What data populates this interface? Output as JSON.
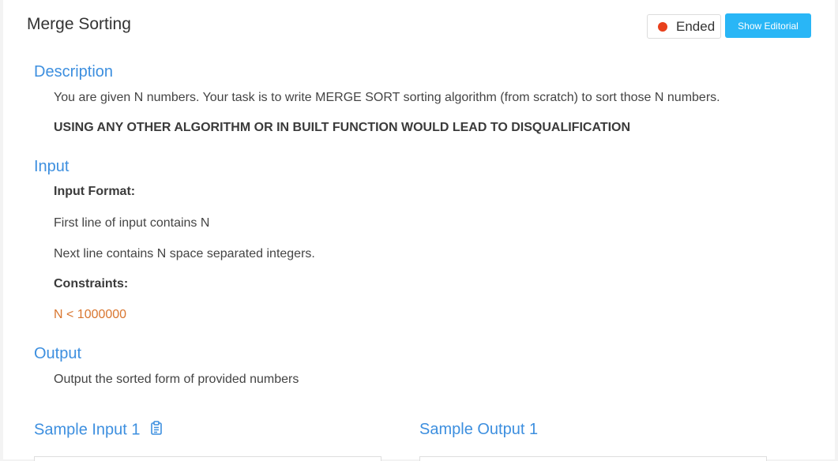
{
  "problem": {
    "title": "Merge Sorting"
  },
  "header": {
    "status_label": "Ended",
    "editorial_button_label": "Show Editorial"
  },
  "colors": {
    "accent_blue": "#3d8fdf",
    "button_blue": "#29b6f6",
    "status_red": "#e8401c",
    "constraint_orange": "#d9762f"
  },
  "description": {
    "heading": "Description",
    "text": "You are given N numbers. Your task is to write MERGE SORT sorting algorithm (from scratch) to sort those N numbers.",
    "warning": "USING ANY OTHER ALGORITHM OR IN BUILT FUNCTION WOULD LEAD TO DISQUALIFICATION"
  },
  "input": {
    "heading": "Input",
    "format_label": "Input Format:",
    "line1": "First line of input contains N",
    "line2": "Next line contains N space separated integers.",
    "constraints_label": "Constraints:",
    "constraint": "N < 1000000"
  },
  "output": {
    "heading": "Output",
    "text": "Output the sorted form of provided numbers"
  },
  "samples": {
    "input_heading": "Sample Input 1",
    "output_heading": "Sample Output 1",
    "copy_icon": "clipboard-icon"
  }
}
